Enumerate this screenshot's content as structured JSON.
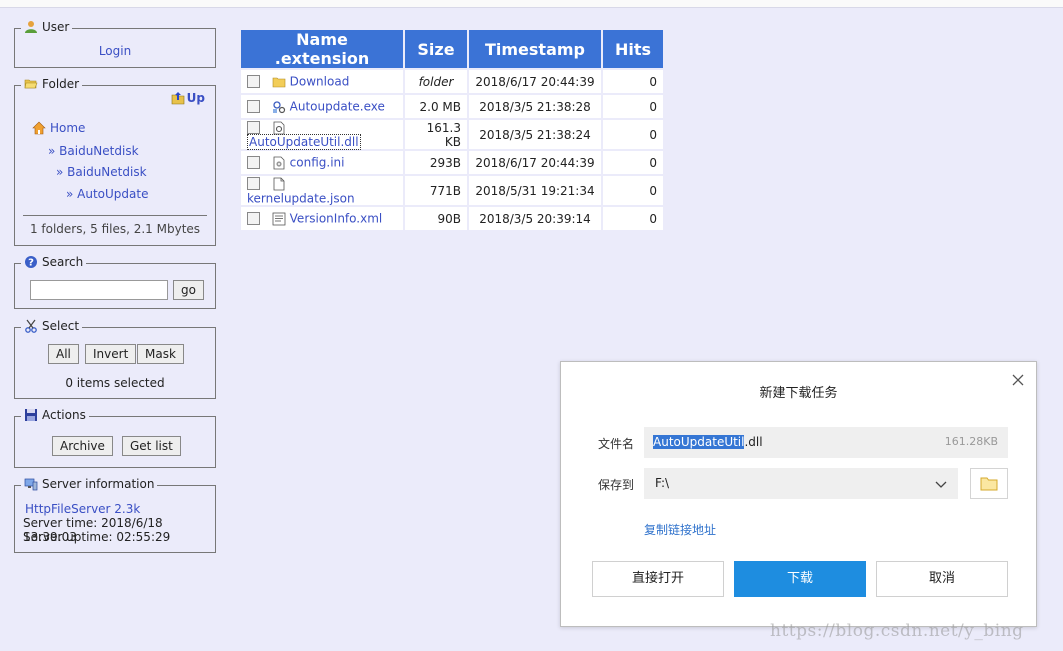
{
  "user": {
    "title": "User",
    "login": "Login"
  },
  "folder": {
    "title": "Folder",
    "up": "Up",
    "home": "Home",
    "path": [
      "» BaiduNetdisk",
      "» BaiduNetdisk",
      "» AutoUpdate"
    ],
    "summary": "1 folders, 5 files, 2.1 Mbytes"
  },
  "search": {
    "title": "Search",
    "value": "",
    "go": "go"
  },
  "select": {
    "title": "Select",
    "all": "All",
    "invert": "Invert",
    "mask": "Mask",
    "status": "0 items selected"
  },
  "actions": {
    "title": "Actions",
    "archive": "Archive",
    "getlist": "Get list"
  },
  "server": {
    "title": "Server information",
    "name": "HttpFileServer 2.3k",
    "time": "Server time: 2018/6/18 13:39:03",
    "uptime": "Server uptime: 02:55:29"
  },
  "table": {
    "headers": [
      "Name .extension",
      "Size",
      "Timestamp",
      "Hits"
    ],
    "rows": [
      {
        "name": "Download",
        "icon": "folder-icon",
        "size": "folder",
        "timestamp": "2018/6/17 20:44:39",
        "hits": "0"
      },
      {
        "name": "Autoupdate.exe",
        "icon": "exe-icon",
        "size": "2.0 MB",
        "timestamp": "2018/3/5 21:38:28",
        "hits": "0"
      },
      {
        "name": "AutoUpdateUtil.dll",
        "icon": "dll-icon",
        "size": "161.3 KB",
        "timestamp": "2018/3/5 21:38:24",
        "hits": "0"
      },
      {
        "name": "config.ini",
        "icon": "ini-icon",
        "size": "293B",
        "timestamp": "2018/6/17 20:44:39",
        "hits": "0"
      },
      {
        "name": "kernelupdate.json",
        "icon": "file-icon",
        "size": "771B",
        "timestamp": "2018/5/31 19:21:34",
        "hits": "0"
      },
      {
        "name": "VersionInfo.xml",
        "icon": "xml-icon",
        "size": "90B",
        "timestamp": "2018/3/5 20:39:14",
        "hits": "0"
      }
    ]
  },
  "dialog": {
    "title": "新建下载任务",
    "filename_label": "文件名",
    "filename_selected": "AutoUpdateUtil",
    "filename_ext": ".dll",
    "filename_size": "161.28KB",
    "saveto_label": "保存到",
    "saveto_value": "F:\\",
    "copy_link": "复制链接地址",
    "open_direct": "直接打开",
    "download": "下载",
    "cancel": "取消"
  },
  "watermark": "https://blog.csdn.net/y_bing",
  "colors": {
    "header_blue": "#3b73d6",
    "link_blue": "#3a4fc4",
    "primary_button": "#1e8de0",
    "page_background": "#ebebfa"
  }
}
